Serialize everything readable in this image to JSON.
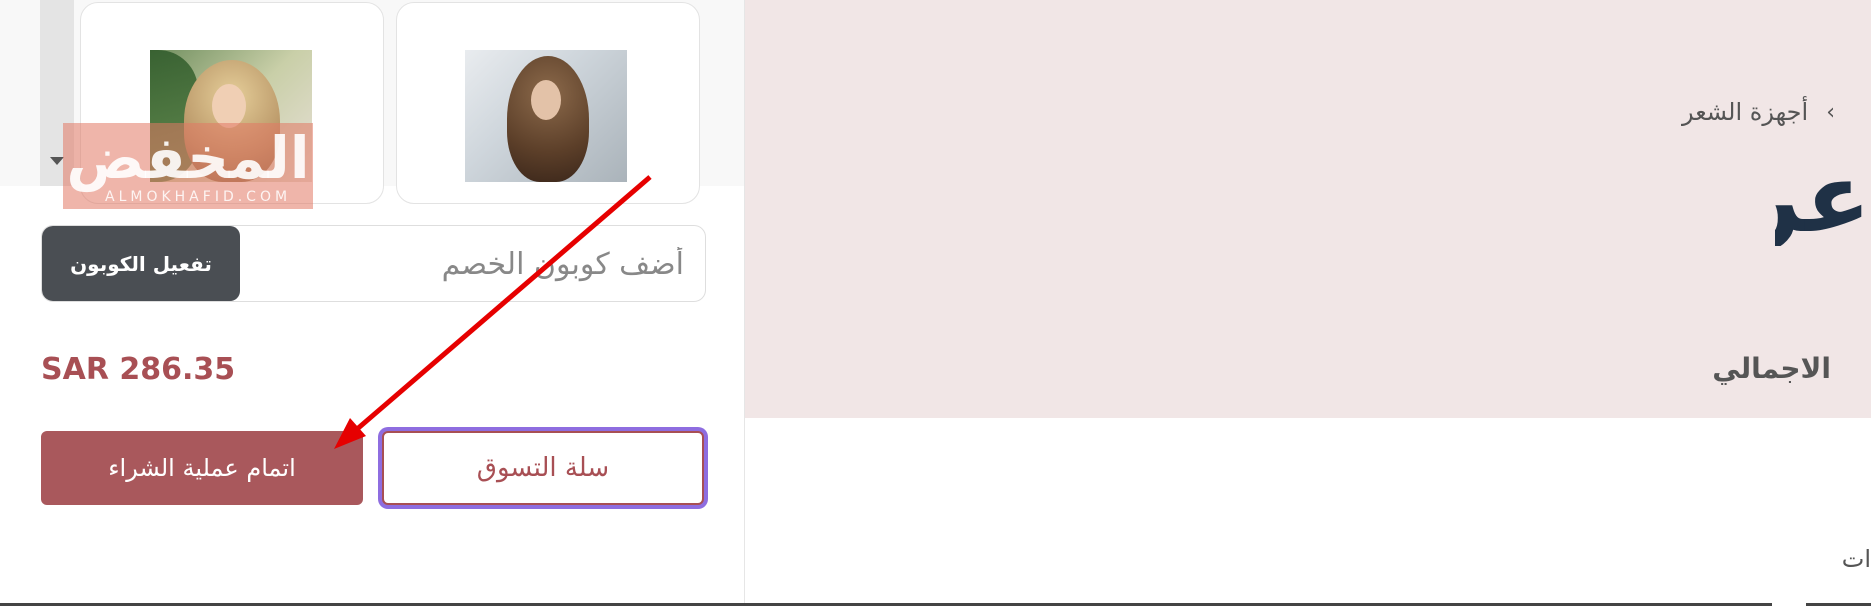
{
  "page": {
    "breadcrumb": {
      "current": "أجهزة الشعر"
    },
    "hero_title_fragment": "عر",
    "bottom_text_fragment": "ات"
  },
  "cart_panel": {
    "products": [
      {
        "image_alt": "شعر بني طويل"
      },
      {
        "image_alt": "شعر أشقر طويل"
      }
    ],
    "watermark": {
      "arabic": "المخفض",
      "english": "ALMOKHAFID.COM"
    },
    "coupon": {
      "placeholder": "أضف كوبون الخصم",
      "apply_label": "تفعيل الكوبون"
    },
    "total": {
      "label": "الاجمالي",
      "value": "SAR 286.35"
    },
    "actions": {
      "checkout_label": "اتمام عملية الشراء",
      "cart_label": "سلة التسوق"
    }
  },
  "colors": {
    "brand": "#a84f54",
    "hero_bg": "#f1e6e6",
    "coupon_button": "#4a4e53",
    "focus_ring": "#8e6de0",
    "annotation_arrow": "#e60000"
  },
  "icons": {
    "breadcrumb_separator": "chevron-right-icon",
    "dropdown": "caret-down-icon"
  }
}
